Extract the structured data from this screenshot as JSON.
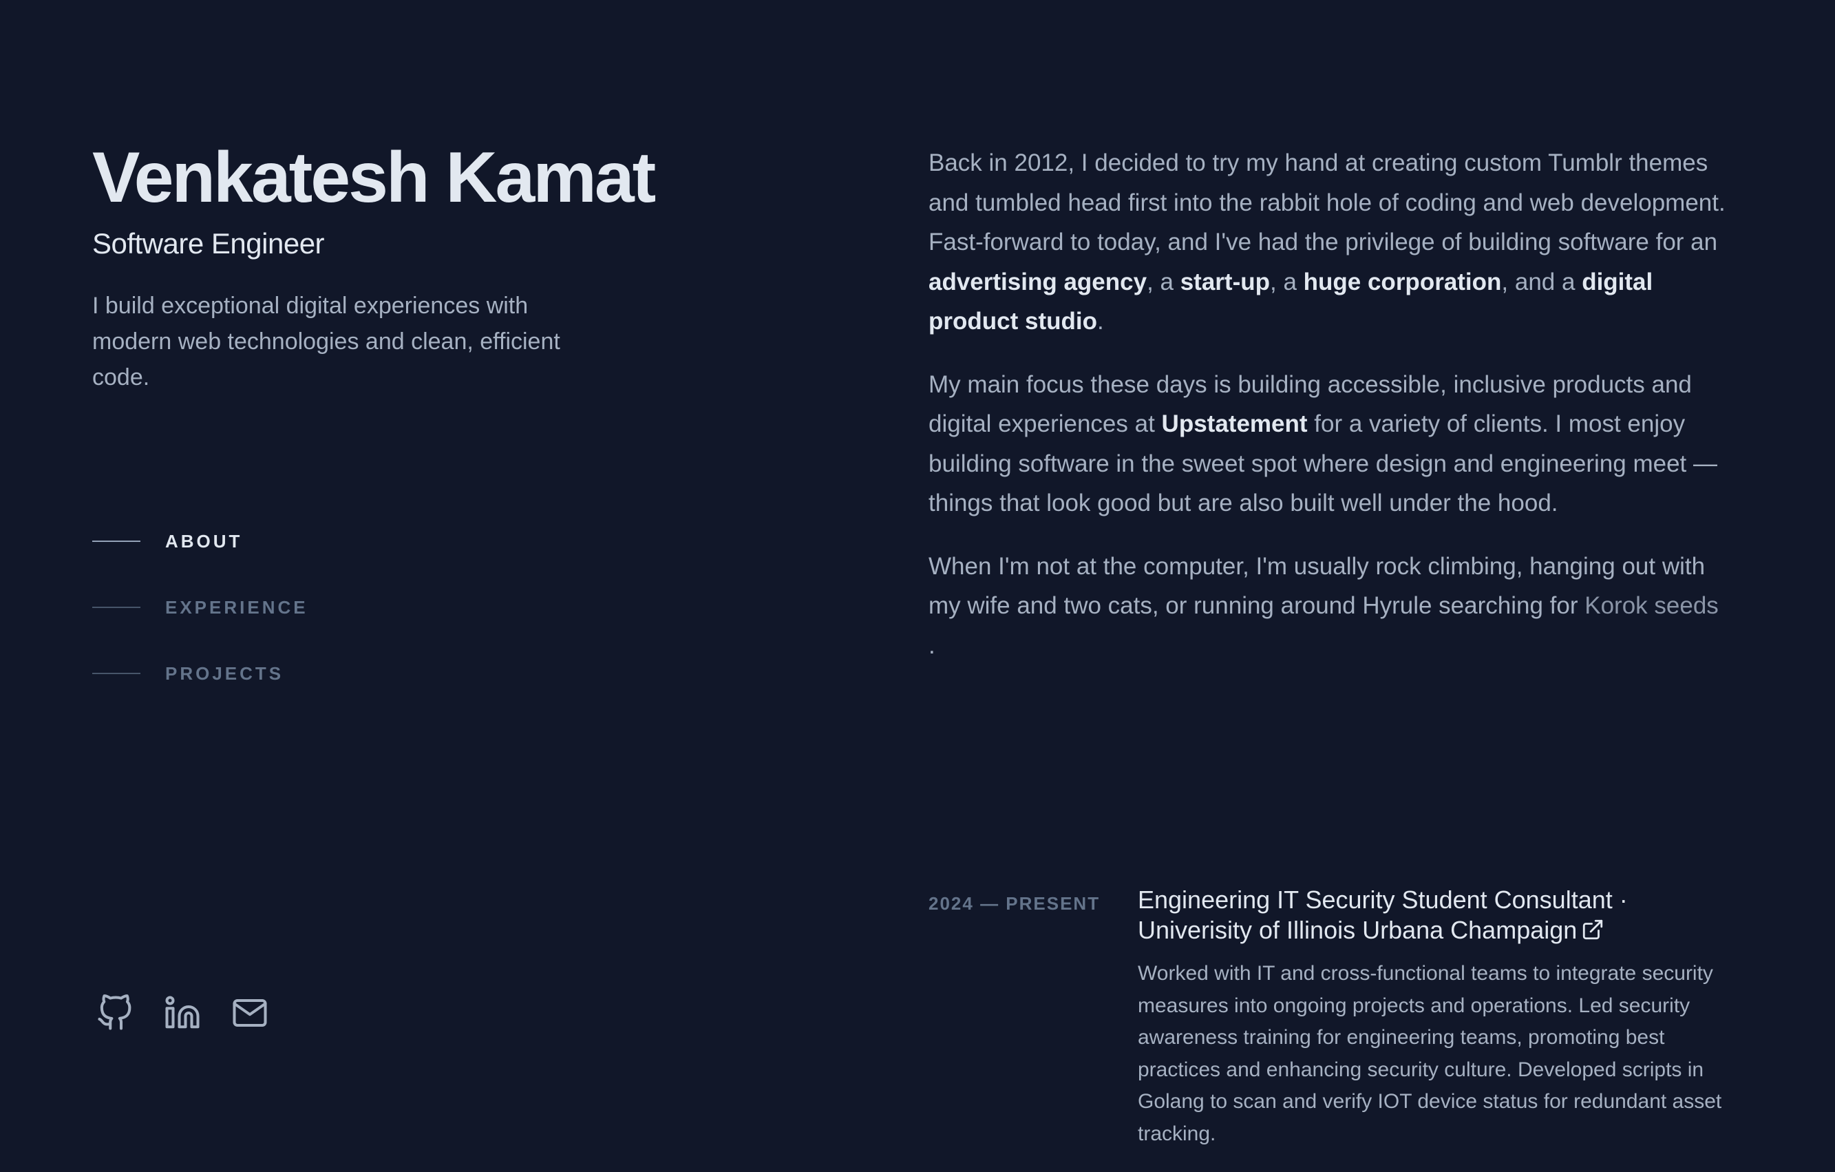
{
  "header": {
    "name": "Venkatesh Kamat",
    "role": "Software Engineer",
    "tagline": "I build exceptional digital experiences with modern web technologies and clean, efficient code."
  },
  "nav": {
    "items": [
      {
        "label": "ABOUT",
        "active": true
      },
      {
        "label": "EXPERIENCE",
        "active": false
      },
      {
        "label": "PROJECTS",
        "active": false
      }
    ]
  },
  "socials": {
    "icons": [
      "github-icon",
      "linkedin-icon",
      "mail-icon"
    ]
  },
  "about": {
    "p1_a": "Back in 2012, I decided to try my hand at creating custom Tumblr themes and tumbled head first into the rabbit hole of coding and web development. Fast-forward to today, and I've had the privilege of building software for an ",
    "p1_b1": "advertising agency",
    "p1_c": ", a ",
    "p1_b2": "start-up",
    "p1_d": ", a ",
    "p1_b3": "huge corporation",
    "p1_e": ", and a ",
    "p1_b4": "digital product studio",
    "p1_f": ".",
    "p2_a": "My main focus these days is building accessible, inclusive products and digital experiences at ",
    "p2_b": "Upstatement",
    "p2_c": " for a variety of clients. I most enjoy building software in the sweet spot where design and engineering meet — things that look good but are also built well under the hood.",
    "p3_a": "When I'm not at the computer, I'm usually rock climbing, hanging out with my wife and two cats, or running around Hyrule searching for ",
    "p3_link": "Korok seeds",
    "p3_b": "."
  },
  "experience": {
    "items": [
      {
        "date": "2024 — PRESENT",
        "title_line1": "Engineering IT Security Student Consultant ·",
        "title_line2": "Univerisity of Illinois Urbana Champaign",
        "description": "Worked with IT and cross-functional teams to integrate security measures into ongoing projects and operations. Led security awareness training for engineering teams, promoting best practices and enhancing security culture. Developed scripts in Golang to scan and verify IOT device status for redundant asset tracking."
      }
    ]
  },
  "colors": {
    "background": "#111729",
    "heading": "#e2e8f0",
    "body": "#a6b1c2",
    "muted": "#64748b"
  }
}
